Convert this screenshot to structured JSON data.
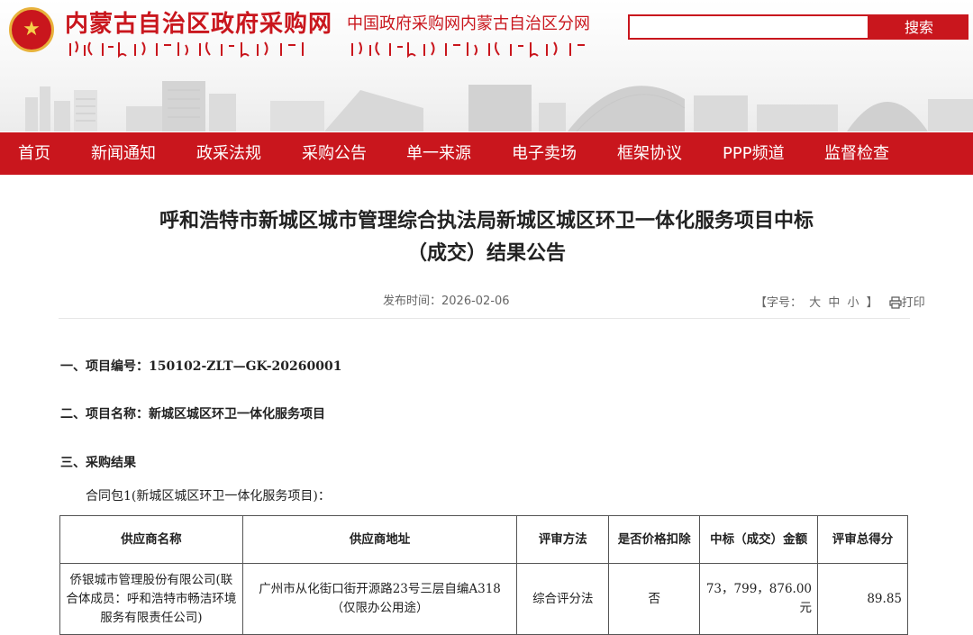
{
  "header": {
    "site_title": "内蒙古自治区政府采购网",
    "sub_title": "中国政府采购网内蒙古自治区分网",
    "search_placeholder": "",
    "search_button": "搜索"
  },
  "nav": {
    "items": [
      "首页",
      "新闻通知",
      "政采法规",
      "采购公告",
      "单一来源",
      "电子卖场",
      "框架协议",
      "PPP频道",
      "监督检查"
    ]
  },
  "article": {
    "title_line1": "呼和浩特市新城区城市管理综合执法局新城区城区环卫一体化服务项目中标",
    "title_line2": "（成交）结果公告",
    "publish_label": "发布时间：",
    "publish_date": "2026-02-06",
    "font_size_label": "【字号：",
    "size_large": "大",
    "size_medium": "中",
    "size_small": "小",
    "font_size_end": "】",
    "print_label": "打印",
    "project_no_label": "一、项目编号：",
    "project_no": "150102-ZLT—GK-20260001",
    "project_name_label": "二、项目名称：",
    "project_name": "新城区城区环卫一体化服务项目",
    "result_label": "三、采购结果",
    "package_text": "合同包1(新城区城区环卫一体化服务项目)："
  },
  "table": {
    "headers": [
      "供应商名称",
      "供应商地址",
      "评审方法",
      "是否价格扣除",
      "中标（成交）金额",
      "评审总得分"
    ],
    "rows": [
      {
        "supplier": "侨银城市管理股份有限公司(联合体成员：呼和浩特市畅洁环境服务有限责任公司)",
        "address": "广州市从化街口街开源路23号三层自编A318（仅限办公用途）",
        "method": "综合评分法",
        "price_deduction": "否",
        "amount": "73，799，876.00元",
        "score": "89.85"
      }
    ]
  },
  "colors": {
    "brand_red": "#c9161d",
    "emblem_gold": "#e8b23c"
  },
  "icons": [
    "national-emblem-icon",
    "print-icon"
  ]
}
